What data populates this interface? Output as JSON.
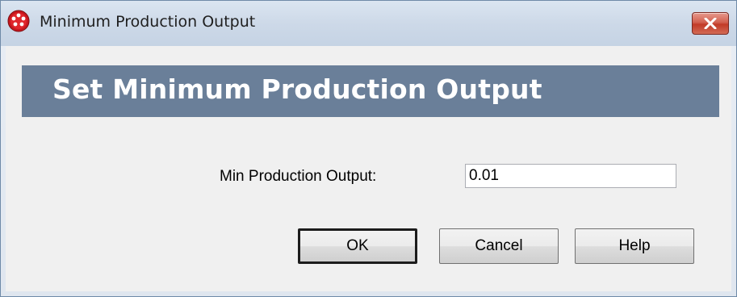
{
  "window": {
    "title": "Minimum Production Output",
    "app_icon": "red-gear-icon",
    "close_icon": "close-icon"
  },
  "banner": {
    "title": "Set Minimum Production Output"
  },
  "form": {
    "min_output_label": "Min Production Output:",
    "min_output_value": "0.01"
  },
  "buttons": {
    "ok": "OK",
    "cancel": "Cancel",
    "help": "Help"
  },
  "colors": {
    "banner_bg": "#6a7f99",
    "close_button": "#c23b27",
    "title_bar": "#cdd9e8"
  }
}
